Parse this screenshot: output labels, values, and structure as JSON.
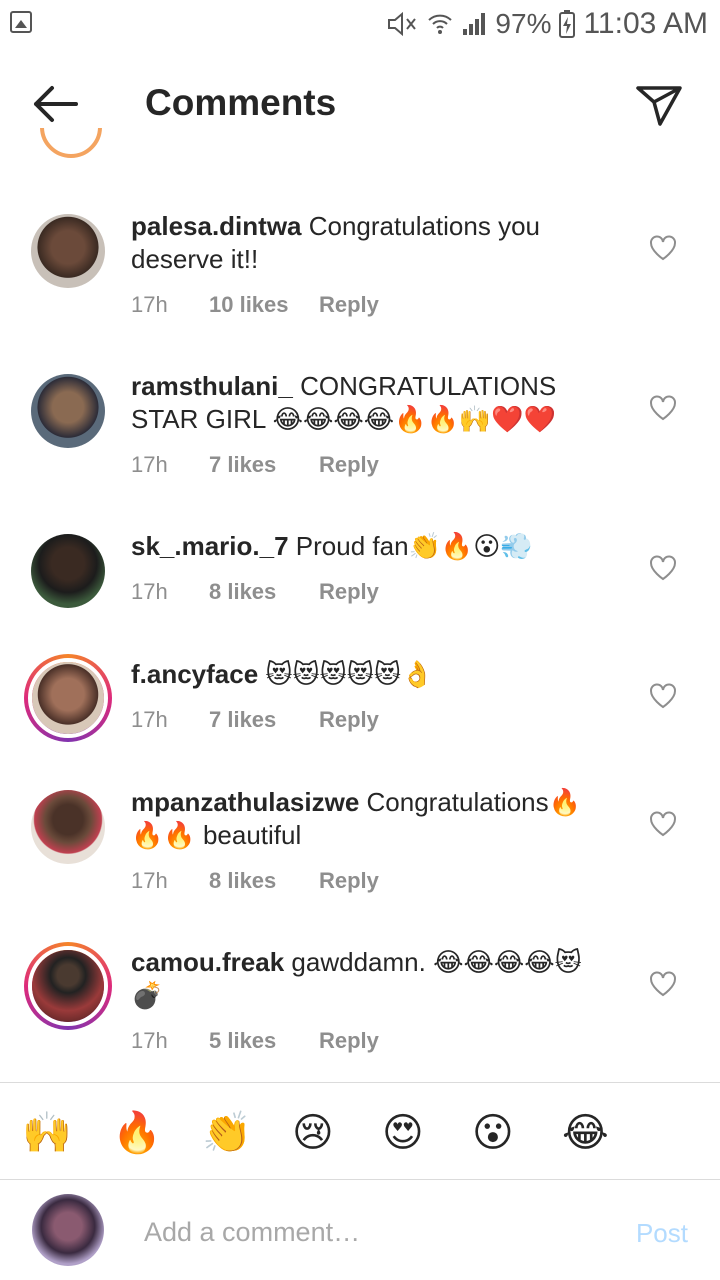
{
  "status_bar": {
    "battery": "97%",
    "time": "11:03 AM"
  },
  "header": {
    "title": "Comments",
    "back_icon": "arrow-left-icon",
    "send_icon": "paper-plane-icon"
  },
  "comments": [
    {
      "username": "palesa.dintwa",
      "text": "Congratulations you deserve it!!",
      "time": "17h",
      "likes": "10 likes",
      "reply": "Reply"
    },
    {
      "username": "ramsthulani_",
      "text": "CONGRATULATIONS STAR GIRL 😂😂😂😂🔥🔥🙌❤️❤️",
      "time": "17h",
      "likes": "7 likes",
      "reply": "Reply"
    },
    {
      "username": "sk_.mario._7",
      "text": "Proud fan👏🔥😮💨",
      "time": "17h",
      "likes": "8 likes",
      "reply": "Reply"
    },
    {
      "username": "f.ancyface",
      "text": "😻😻😻😻😻👌",
      "time": "17h",
      "likes": "7 likes",
      "reply": "Reply"
    },
    {
      "username": "mpanzathulasizwe",
      "text": "Congratulations🔥🔥🔥 beautiful",
      "time": "17h",
      "likes": "8 likes",
      "reply": "Reply"
    },
    {
      "username": "camou.freak",
      "text": "gawddamn. 😂😂😂😂😻💣",
      "time": "17h",
      "likes": "5 likes",
      "reply": "Reply"
    }
  ],
  "quick_emojis": [
    "🙌",
    "🔥",
    "👏",
    "😢",
    "😍",
    "😮",
    "😂"
  ],
  "composer": {
    "placeholder": "Add a comment…",
    "post_label": "Post"
  },
  "colors": {
    "text": "#262626",
    "meta": "#8e8e8e",
    "post_disabled": "#b3dbff"
  }
}
